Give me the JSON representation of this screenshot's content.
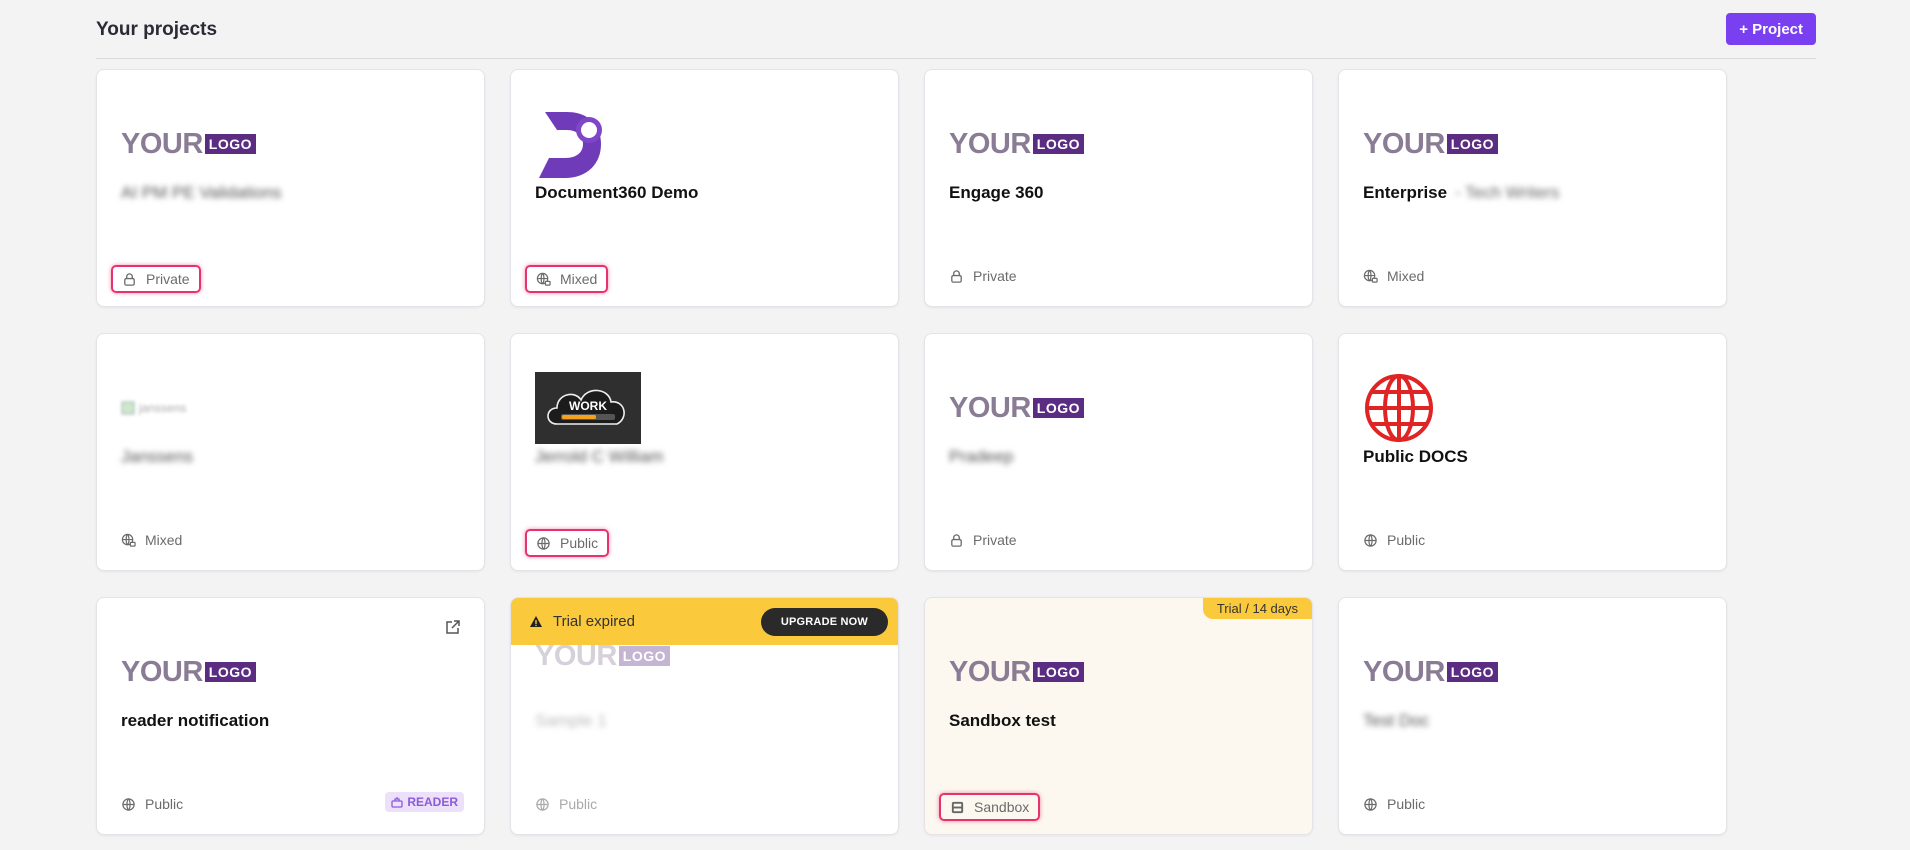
{
  "header": {
    "title": "Your projects",
    "new_project_label": "+ Project"
  },
  "logo_text": {
    "your": "YOUR",
    "logo": "LOGO"
  },
  "projects": [
    {
      "name": "AI PM PE Validations",
      "access": "Private",
      "logo": "yourlogo"
    },
    {
      "name": "Document360 Demo",
      "access": "Mixed",
      "logo": "d360"
    },
    {
      "name": "Engage 360",
      "access": "Private",
      "logo": "yourlogo"
    },
    {
      "name": "Enterprise",
      "name_suffix": "- Tech Writers",
      "access": "Mixed",
      "logo": "yourlogo"
    },
    {
      "name": "Janssens",
      "access": "Mixed",
      "logo": "broken-image",
      "logo_alt": "janssens"
    },
    {
      "name": "Jerrold C William",
      "access": "Public",
      "logo": "work-cloud"
    },
    {
      "name": "Pradeep",
      "access": "Private",
      "logo": "yourlogo"
    },
    {
      "name": "Public DOCS",
      "access": "Public",
      "logo": "globe"
    },
    {
      "name": "reader notification",
      "access": "Public",
      "logo": "yourlogo",
      "badge": "READER"
    },
    {
      "name": "Sample 1",
      "access": "Public",
      "logo": "yourlogo",
      "trial_message": "Trial expired",
      "upgrade_label": "UPGRADE NOW"
    },
    {
      "name": "Sandbox test",
      "access": "Sandbox",
      "logo": "yourlogo",
      "trial_days": "Trial / 14 days"
    },
    {
      "name": "Test Doc",
      "access": "Public",
      "logo": "yourlogo"
    }
  ],
  "colors": {
    "accent": "#7b3ff2",
    "highlight": "#e6336e",
    "trial": "#fbc93c",
    "logo_purple": "#5a2d82"
  }
}
